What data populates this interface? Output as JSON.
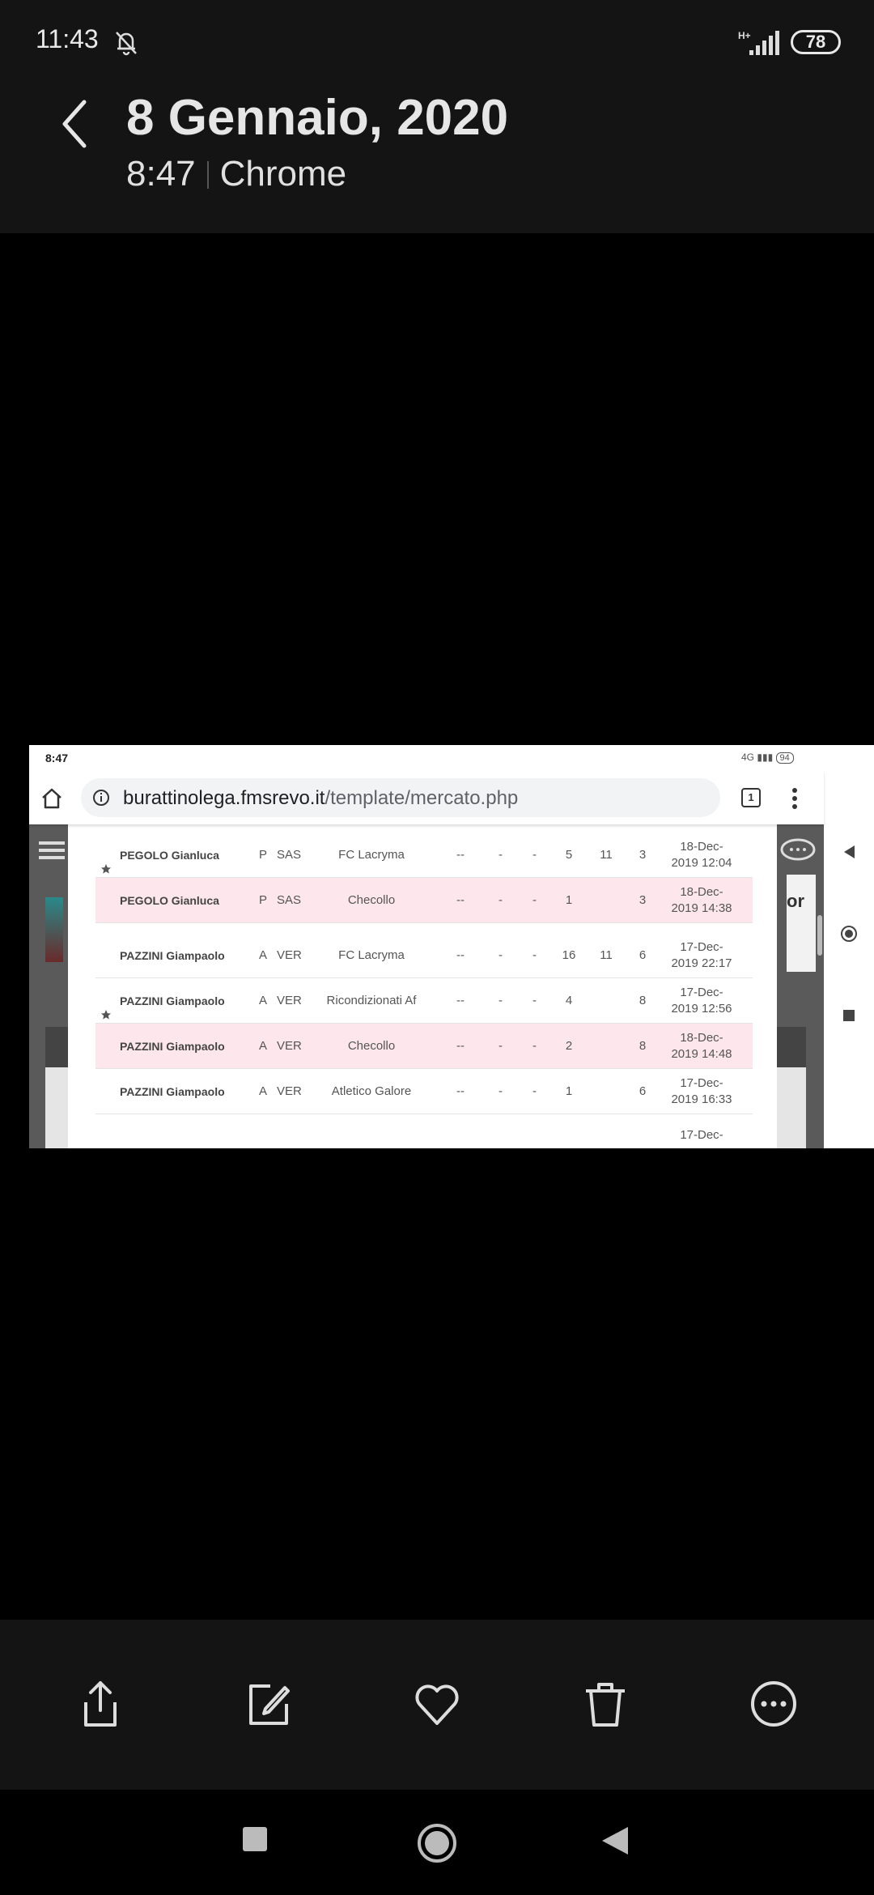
{
  "status_bar": {
    "time": "11:43",
    "network": "H+",
    "battery": "78"
  },
  "header": {
    "title": "8 Gennaio, 2020",
    "time": "8:47",
    "app": "Chrome"
  },
  "screenshot": {
    "status": {
      "time": "8:47",
      "network": "4G",
      "battery": "94"
    },
    "browser": {
      "url_host": "burattinolega.fmsrevo.it",
      "url_path": "/template/mercato.php",
      "tab_count": "1"
    },
    "page": {
      "panel_text": "or"
    },
    "rows": [
      {
        "starred": true,
        "highlight": false,
        "name": "PEGOLO Gianluca",
        "role": "P",
        "club": "SAS",
        "team": "FC Lacryma",
        "c1": "--",
        "c2": "-",
        "c3": "-",
        "c4": "5",
        "c5": "11",
        "c6": "3",
        "date_1": "18-Dec-",
        "date_2": "2019 12:04"
      },
      {
        "starred": false,
        "highlight": true,
        "name": "PEGOLO Gianluca",
        "role": "P",
        "club": "SAS",
        "team": "Checollo",
        "c1": "--",
        "c2": "-",
        "c3": "-",
        "c4": "1",
        "c5": "",
        "c6": "3",
        "date_1": "18-Dec-",
        "date_2": "2019 14:38"
      },
      {
        "starred": false,
        "highlight": false,
        "name": "PAZZINI Giampaolo",
        "role": "A",
        "club": "VER",
        "team": "FC Lacryma",
        "c1": "--",
        "c2": "-",
        "c3": "-",
        "c4": "16",
        "c5": "11",
        "c6": "6",
        "date_1": "17-Dec-",
        "date_2": "2019 22:17"
      },
      {
        "starred": true,
        "highlight": false,
        "name": "PAZZINI Giampaolo",
        "role": "A",
        "club": "VER",
        "team": "Ricondizionati Af",
        "c1": "--",
        "c2": "-",
        "c3": "-",
        "c4": "4",
        "c5": "",
        "c6": "8",
        "date_1": "17-Dec-",
        "date_2": "2019 12:56"
      },
      {
        "starred": false,
        "highlight": true,
        "name": "PAZZINI Giampaolo",
        "role": "A",
        "club": "VER",
        "team": "Checollo",
        "c1": "--",
        "c2": "-",
        "c3": "-",
        "c4": "2",
        "c5": "",
        "c6": "8",
        "date_1": "18-Dec-",
        "date_2": "2019 14:48"
      },
      {
        "starred": false,
        "highlight": false,
        "name": "PAZZINI Giampaolo",
        "role": "A",
        "club": "VER",
        "team": "Atletico Galore",
        "c1": "--",
        "c2": "-",
        "c3": "-",
        "c4": "1",
        "c5": "",
        "c6": "6",
        "date_1": "17-Dec-",
        "date_2": "2019 16:33"
      }
    ],
    "partial_date": "17-Dec-"
  },
  "actions": [
    "share",
    "edit",
    "favorite",
    "delete",
    "more"
  ],
  "colors": {
    "gallery_bg": "#141414",
    "highlight_row": "#fde7ec"
  }
}
